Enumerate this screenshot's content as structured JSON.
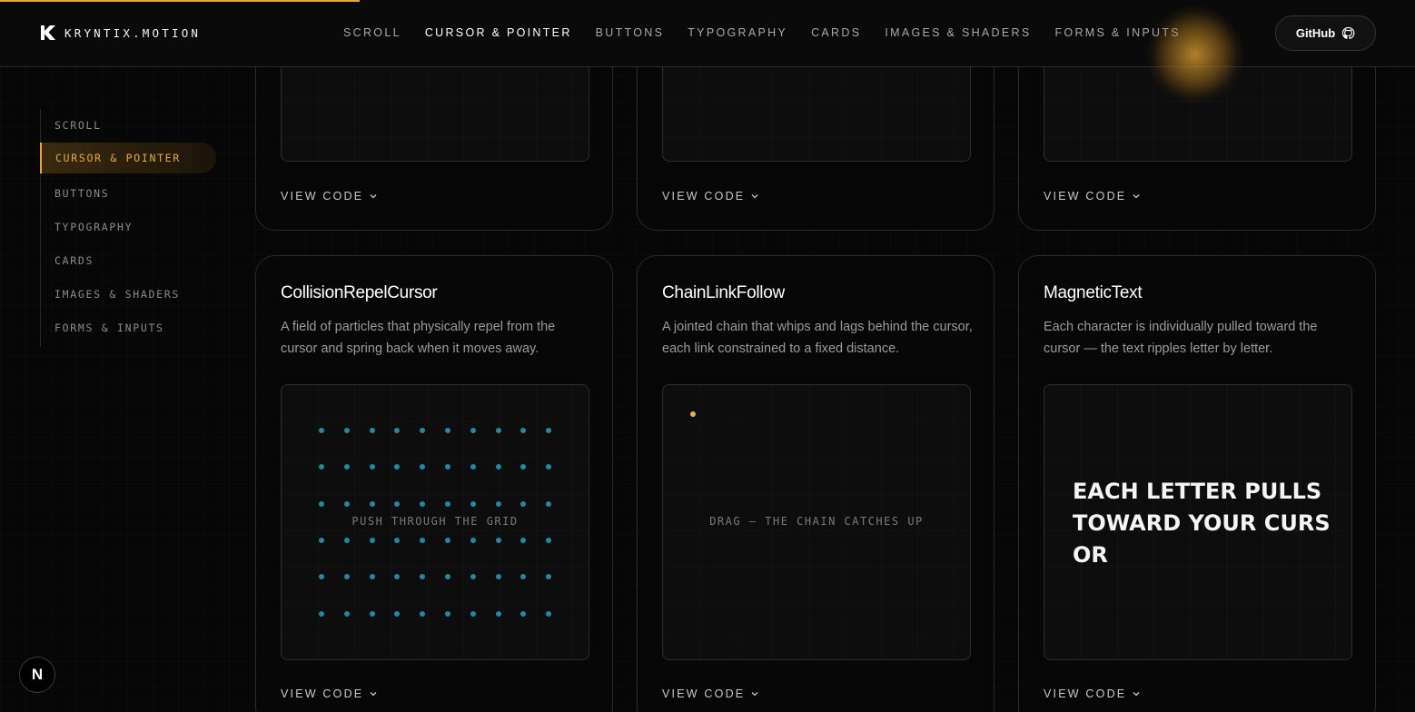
{
  "progress_fraction": 0.254,
  "accent_color": "#e8a830",
  "brand": {
    "name": "KRYNTIX.MOTION",
    "logo_icon": "k-logo-icon"
  },
  "topnav": [
    {
      "label": "SCROLL",
      "active": false
    },
    {
      "label": "CURSOR & POINTER",
      "active": true
    },
    {
      "label": "BUTTONS",
      "active": false
    },
    {
      "label": "TYPOGRAPHY",
      "active": false
    },
    {
      "label": "CARDS",
      "active": false
    },
    {
      "label": "IMAGES & SHADERS",
      "active": false
    },
    {
      "label": "FORMS & INPUTS",
      "active": false
    }
  ],
  "github": {
    "label": "GitHub",
    "icon": "github-icon"
  },
  "sidebar": [
    {
      "label": "SCROLL",
      "active": false
    },
    {
      "label": "CURSOR & POINTER",
      "active": true
    },
    {
      "label": "BUTTONS",
      "active": false
    },
    {
      "label": "TYPOGRAPHY",
      "active": false
    },
    {
      "label": "CARDS",
      "active": false
    },
    {
      "label": "IMAGES & SHADERS",
      "active": false
    },
    {
      "label": "FORMS & INPUTS",
      "active": false
    }
  ],
  "top_cards": [
    {
      "view_code": "VIEW CODE"
    },
    {
      "view_code": "VIEW CODE"
    },
    {
      "view_code": "VIEW CODE"
    }
  ],
  "cards": [
    {
      "title": "CollisionRepelCursor",
      "description": "A field of particles that physically repel from the cursor and spring back when it moves away.",
      "hint": "PUSH THROUGH THE GRID",
      "view_code": "VIEW CODE"
    },
    {
      "title": "ChainLinkFollow",
      "description": "A jointed chain that whips and lags behind the cursor, each link constrained to a fixed distance.",
      "hint": "DRAG — THE CHAIN CATCHES UP",
      "view_code": "VIEW CODE"
    },
    {
      "title": "MagneticText",
      "description": "Each character is individually pulled toward the cursor — the text ripples letter by letter.",
      "demo_text": "EACH LETTER PULLS TOWARD YOUR CURSOR",
      "view_code": "VIEW CODE"
    }
  ],
  "next_badge": "N"
}
